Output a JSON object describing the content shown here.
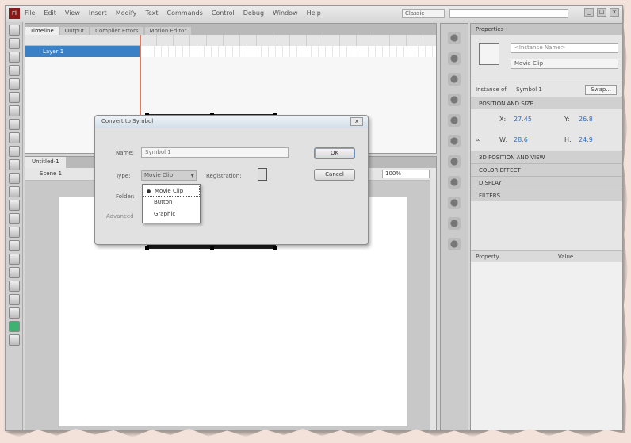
{
  "app": {
    "logo": "Fl",
    "menu": [
      "File",
      "Edit",
      "View",
      "Insert",
      "Modify",
      "Text",
      "Commands",
      "Control",
      "Debug",
      "Window",
      "Help"
    ],
    "workspace": "Classic",
    "window_buttons": [
      "_",
      "□",
      "x"
    ]
  },
  "timeline": {
    "tabs": [
      "Timeline",
      "Output",
      "Compiler Errors",
      "Motion Editor"
    ],
    "layer_name": "Layer 1"
  },
  "stage": {
    "tab_label": "Untitled-1",
    "scene_label": "Scene 1",
    "zoom": "100%"
  },
  "dialog": {
    "title": "Convert to Symbol",
    "name_label": "Name:",
    "name_value": "Symbol 1",
    "type_label": "Type:",
    "type_value": "Movie Clip",
    "registration_label": "Registration:",
    "folder_label": "Folder:",
    "advanced_label": "Advanced",
    "ok_label": "OK",
    "cancel_label": "Cancel",
    "close_label": "x",
    "type_options": [
      "Movie Clip",
      "Button",
      "Graphic"
    ],
    "selected_type_index": 0
  },
  "properties": {
    "tab_label": "Properties",
    "instance_name_placeholder": "<Instance Name>",
    "instance_type": "Movie Clip",
    "instance_of_label": "Instance of:",
    "instance_of_value": "Symbol 1",
    "swap_label": "Swap...",
    "section_position": "POSITION AND SIZE",
    "x_label": "X:",
    "x_value": "27.45",
    "y_label": "Y:",
    "y_value": "26.8",
    "w_label": "W:",
    "w_value": "28.6",
    "h_label": "H:",
    "h_value": "24.9",
    "sections": [
      "3D POSITION AND VIEW",
      "COLOR EFFECT",
      "DISPLAY",
      "FILTERS"
    ],
    "list_col_property": "Property",
    "list_col_value": "Value"
  }
}
